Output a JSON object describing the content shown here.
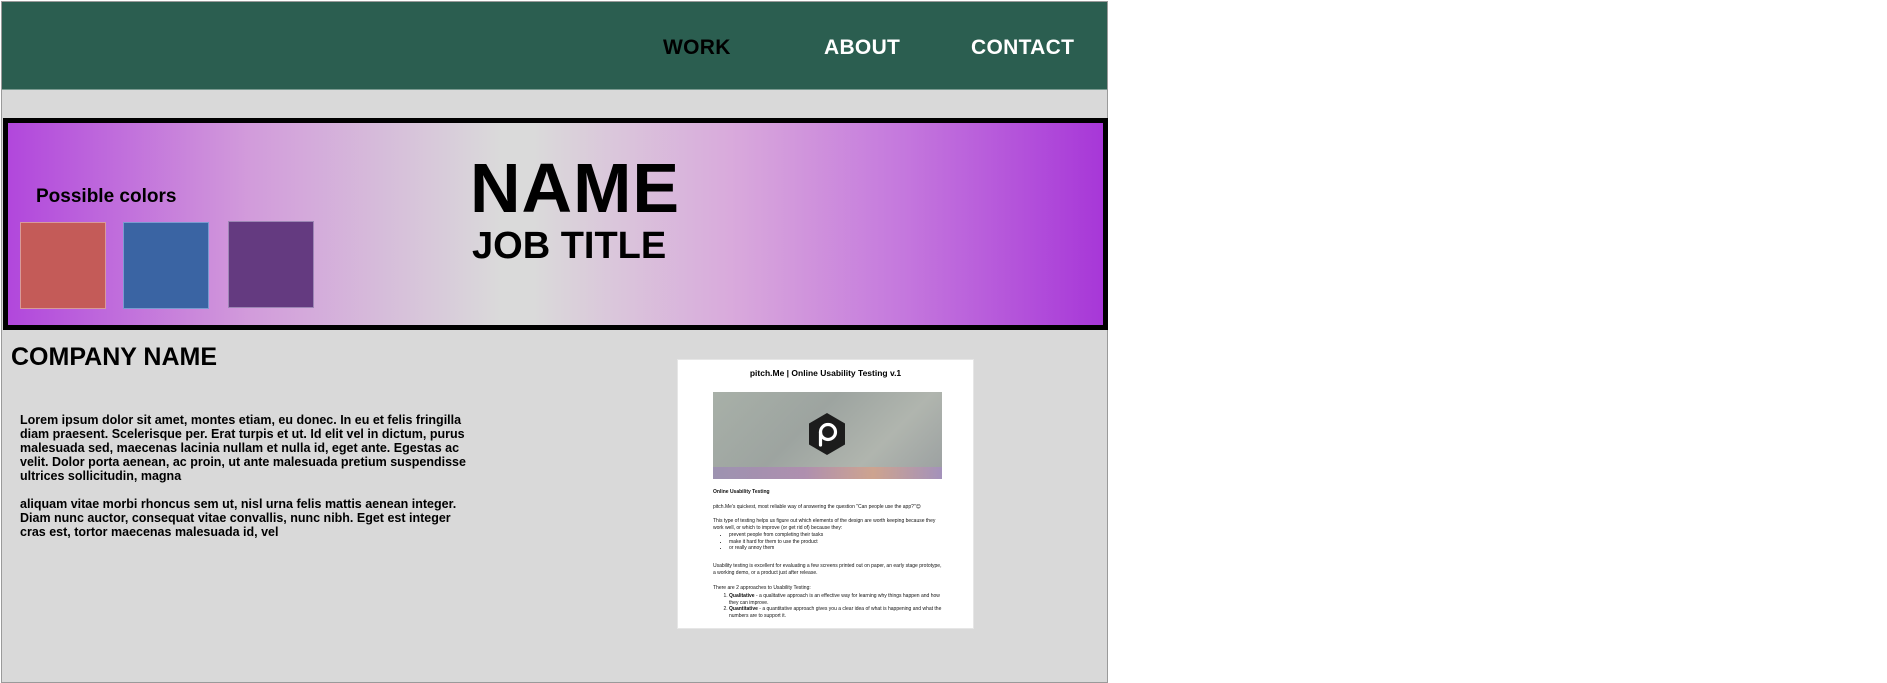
{
  "nav": {
    "items": [
      {
        "label": "WORK"
      },
      {
        "label": "ABOUT"
      },
      {
        "label": "CONTACT"
      }
    ]
  },
  "hero": {
    "colors_title": "Possible colors",
    "swatches": [
      "#c45b58",
      "#3a64a3",
      "#643a80"
    ],
    "name": "NAME",
    "job_title": "JOB TITLE"
  },
  "company": {
    "name": "COMPANY NAME",
    "paragraphs": [
      "Lorem ipsum dolor sit amet, montes etiam, eu donec. In eu et felis fringilla diam praesent. Scelerisque per. Erat turpis et ut. Id elit vel in dictum, purus malesuada sed, maecenas lacinia nullam et nulla id, eget ante. Egestas ac velit. Dolor porta aenean, ac proin, ut ante malesuada pretium suspendisse ultrices sollicitudin, magna",
      "aliquam vitae morbi rhoncus sem ut, nisl urna felis mattis aenean integer. Diam nunc auctor, consequat vitae convallis, nunc nibh. Eget est integer cras est, tortor maecenas malesuada id, vel"
    ]
  },
  "document": {
    "title": "pitch.Me | Online Usability Testing v.1",
    "section_heading": "Online Usability Testing",
    "intro": "pitch.Me's quickest, most reliable way of answering the question \"Can people use the app?\"😊",
    "purpose": "This type of testing helps us figure out which elements of the design are worth keeping because they work well, or which to improve (or get rid of) because they:",
    "bullets": [
      "prevent people from completing their tasks",
      "make it hard for them to use the product",
      "or really annoy them"
    ],
    "usage": "Usability testing is excellent for evaluating a few screens printed out on paper, an early stage prototype, a working demo, or a product just after release.",
    "approaches_intro": "There are 2 approaches to Usability Testing:",
    "approaches": [
      {
        "name": "Qualitative",
        "text": " - a qualitative approach is an effective way for learning why things happen and how they can improve."
      },
      {
        "name": "Quantitative",
        "text": " - a quantitative approach gives you a clear idea of what is happening and what the numbers are to support it."
      }
    ]
  }
}
